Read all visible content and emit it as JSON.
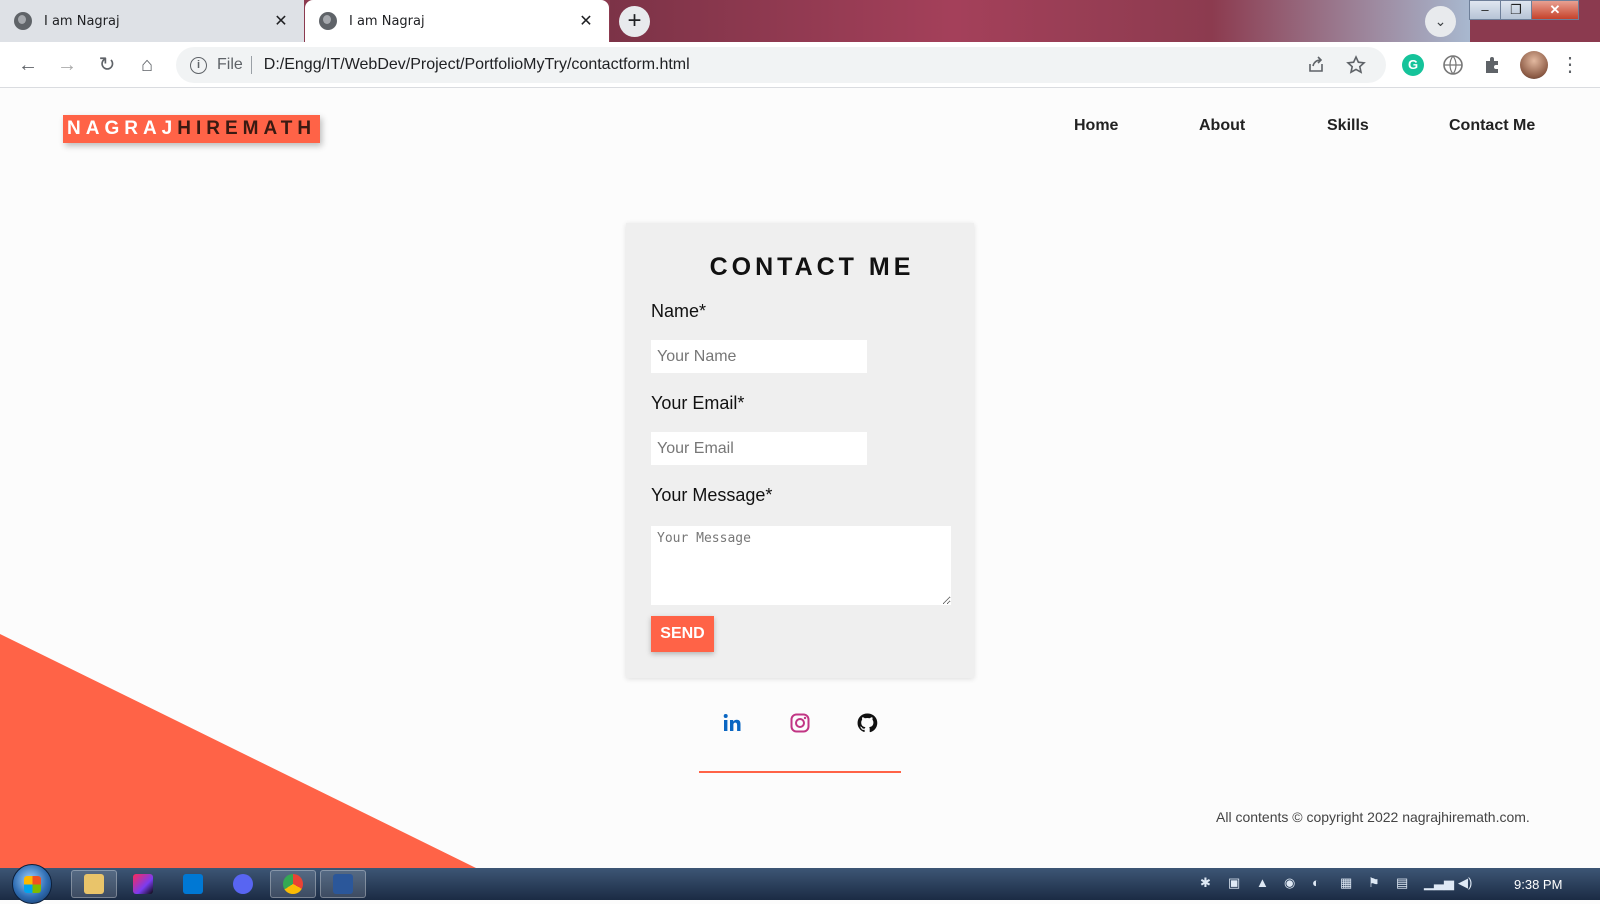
{
  "browser": {
    "tabs": [
      {
        "title": "I am Nagraj",
        "close": "✕"
      },
      {
        "title": "I am Nagraj",
        "close": "✕"
      }
    ],
    "new_tab": "+",
    "tab_search": "⌄",
    "window_buttons": {
      "minimize": "–",
      "restore": "❐",
      "close": "✕"
    },
    "nav": {
      "back": "←",
      "forward": "→",
      "reload": "↻",
      "home": "⌂"
    },
    "address": {
      "scheme": "File",
      "url": "D:/Engg/IT/WebDev/Project/PortfolioMyTry/contactform.html"
    },
    "extensions": {
      "grammarly": "G",
      "menu": "⋮"
    }
  },
  "site": {
    "logo": {
      "first": "NAGRAJ",
      "last": "HIREMATH"
    },
    "nav": [
      "Home",
      "About",
      "Skills",
      "Contact Me"
    ],
    "form": {
      "title": "CONTACT ME",
      "name_label": "Name*",
      "name_placeholder": "Your Name",
      "email_label": "Your Email*",
      "email_placeholder": "Your Email",
      "message_label": "Your Message*",
      "message_placeholder": "Your Message",
      "send": "SEND"
    },
    "social": [
      "linkedin-icon",
      "instagram-icon",
      "github-icon"
    ],
    "footer": "All contents © copyright 2022 nagrajhiremath.com."
  },
  "taskbar": {
    "clock": "9:38 PM"
  },
  "colors": {
    "accent": "#ff6347",
    "linkedin": "#0a66c2",
    "instagram": "#c13584"
  }
}
